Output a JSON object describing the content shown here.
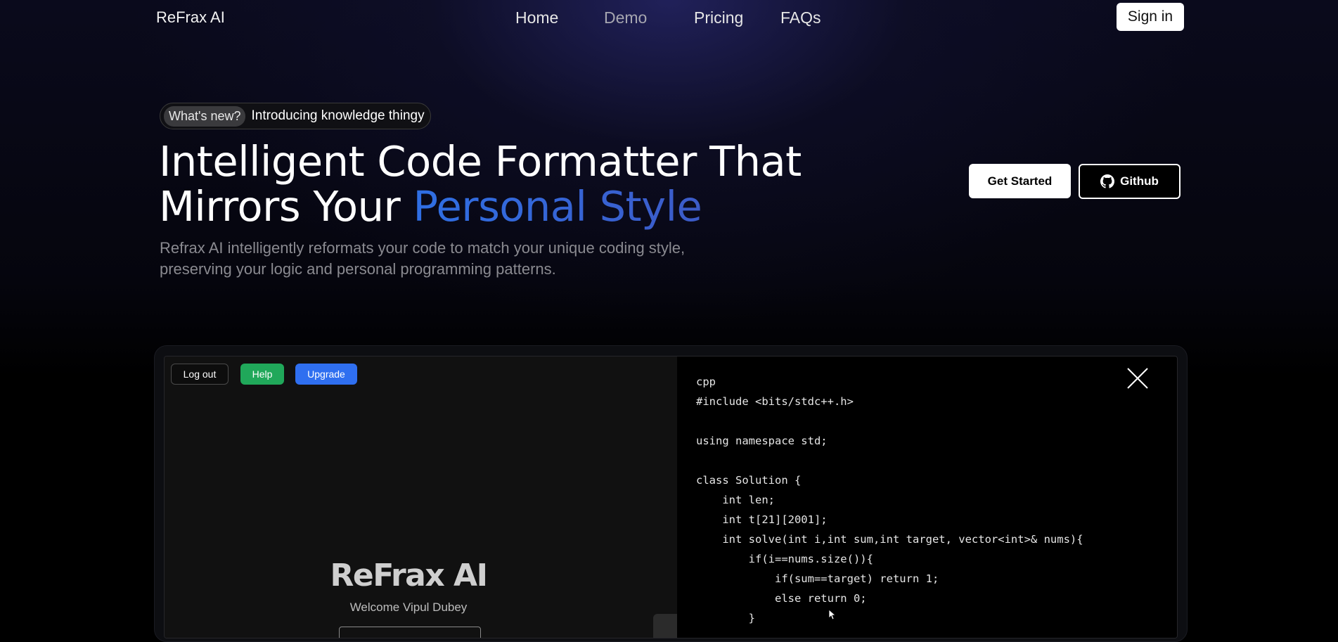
{
  "nav": {
    "logo": "ReFrax AI",
    "links": [
      "Home",
      "Demo",
      "Pricing",
      "FAQs"
    ],
    "signin_label": "Sign in"
  },
  "hero": {
    "badge_pill": "What's new?",
    "badge_text": "Introducing knowledge thingy",
    "title_line1": "Intelligent Code Formatter That",
    "title_line2_plain": "Mirrors Your ",
    "title_line2_accent": "Personal Style",
    "subtitle_line1": "Refrax AI intelligently reformats your code to match your unique coding style,",
    "subtitle_line2": "preserving your logic and personal programming patterns.",
    "get_started_label": "Get Started",
    "github_label": "Github",
    "accent_color": "#2f6fe4"
  },
  "demo_app": {
    "logout_label": "Log out",
    "help_label": "Help",
    "upgrade_label": "Upgrade",
    "brand": "ReFrax AI",
    "welcome": "Welcome Vipul Dubey",
    "help_color": "#20a85a",
    "upgrade_color": "#2f6ff0",
    "code": "cpp\n#include <bits/stdc++.h>\n\nusing namespace std;\n\nclass Solution {\n    int len;\n    int t[21][2001];\n    int solve(int i,int sum,int target, vector<int>& nums){\n        if(i==nums.size()){\n            if(sum==target) return 1;\n            else return 0;\n        }"
  },
  "icons": {
    "github": "github-icon",
    "close": "close-icon",
    "cursor": "mouse-cursor-icon"
  }
}
